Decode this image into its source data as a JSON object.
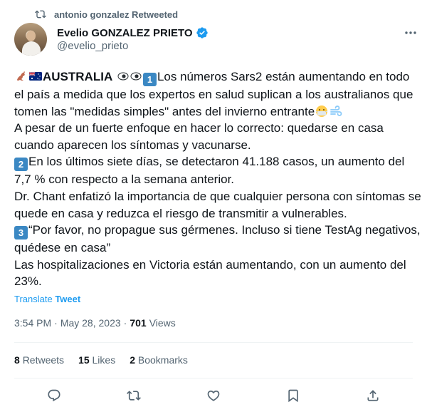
{
  "retweet_banner": {
    "text": "antonio gonzalez Retweeted"
  },
  "author": {
    "name": "Evelio GONZALEZ PRIETO",
    "handle": "@evelio_prieto"
  },
  "tweet": {
    "country": "AUSTRALIA",
    "para1": "Los números Sars2 están aumentando en todo el país a medida que los expertos en salud suplican a los australianos que tomen las \"medidas simples\" antes del invierno entrante",
    "para2": "A pesar de un fuerte enfoque en hacer lo correcto: quedarse en casa cuando aparecen los síntomas y vacunarse.",
    "para3": "En los últimos siete días, se detectaron 41.188 casos, un aumento del 7,7 % con respecto a la semana anterior.",
    "para4": "Dr. Chant enfatizó la importancia de que cualquier persona con síntomas se quede en casa y reduzca el riesgo de transmitir a vulnerables.",
    "para5": "“Por favor, no propague sus gérmenes. Incluso si tiene TestAg negativos, quédese en casa”",
    "para6": "Las hospitalizaciones en Victoria están aumentando, con un aumento del 23%.",
    "keycaps": [
      "1",
      "2",
      "3"
    ]
  },
  "translate": {
    "prefix": "Translate ",
    "suffix": "Tweet"
  },
  "meta": {
    "time": "3:54 PM",
    "dot1": "·",
    "date": "May 28, 2023",
    "dot2": "·",
    "views_count": "701",
    "views_label": "Views"
  },
  "stats": {
    "retweets_count": "8",
    "retweets_label": "Retweets",
    "likes_count": "15",
    "likes_label": "Likes",
    "bookmarks_count": "2",
    "bookmarks_label": "Bookmarks"
  },
  "colors": {
    "accent": "#1d9bf0",
    "muted": "#536471",
    "text": "#0f1419",
    "keycap": "#3b88c3"
  },
  "icons": [
    "retweet-icon",
    "verified-badge-icon",
    "more-icon",
    "kangaroo-icon",
    "australia-flag-icon",
    "eyes-icon",
    "mask-face-icon",
    "wind-icon",
    "reply-icon",
    "like-icon",
    "bookmark-icon",
    "share-icon"
  ]
}
